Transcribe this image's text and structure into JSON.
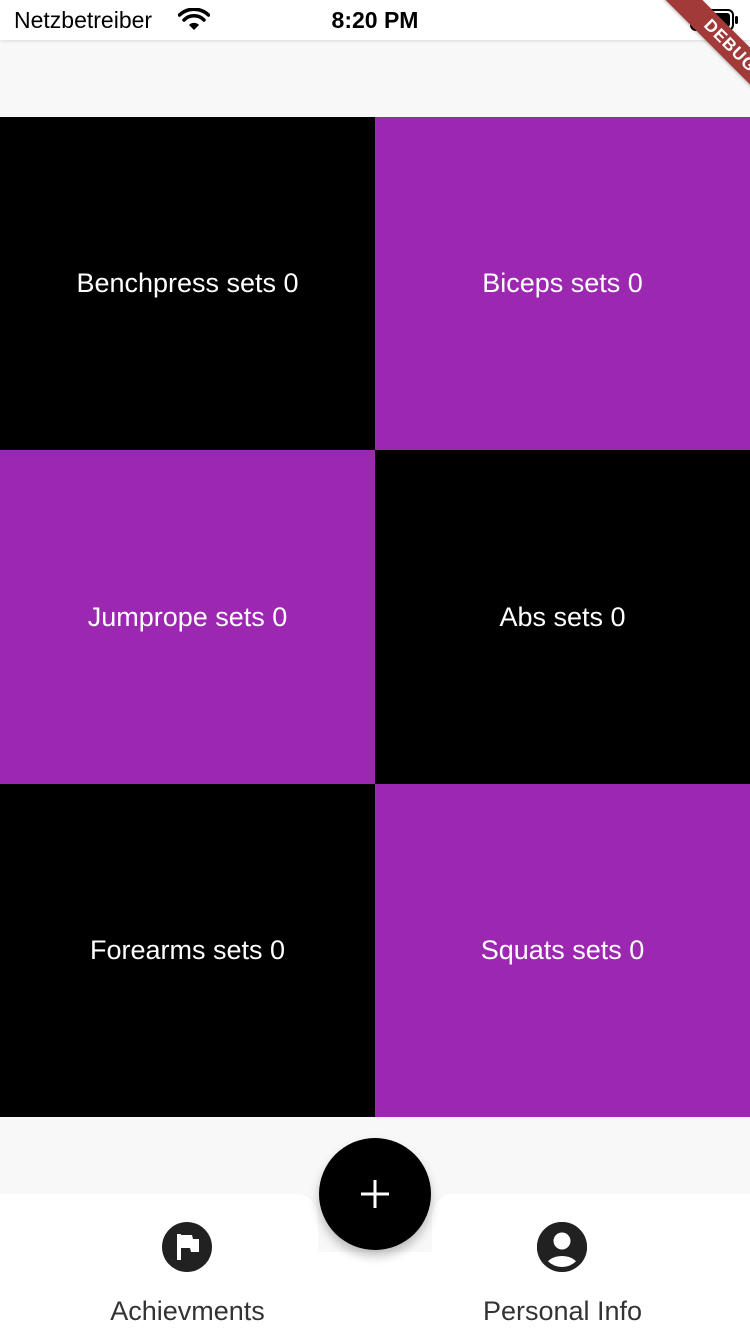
{
  "status_bar": {
    "carrier": "Netzbetreiber",
    "time": "8:20 PM",
    "wifi_icon": "wifi-icon",
    "battery_icon": "battery-full-icon"
  },
  "debug_banner": {
    "label": "DEBUG",
    "color": "#a33a3a"
  },
  "colors": {
    "purple": "#9c27b0",
    "black": "#000000",
    "background": "#f8f8f8"
  },
  "tiles": [
    {
      "label": "Benchpress sets 0",
      "color": "#000000"
    },
    {
      "label": "Biceps sets 0",
      "color": "#9c27b0"
    },
    {
      "label": "Jumprope sets 0",
      "color": "#9c27b0"
    },
    {
      "label": "Abs sets 0",
      "color": "#000000"
    },
    {
      "label": "Forearms sets 0",
      "color": "#000000"
    },
    {
      "label": "Squats sets 0",
      "color": "#9c27b0"
    }
  ],
  "fab": {
    "icon": "plus-icon"
  },
  "bottom_nav": {
    "items": [
      {
        "label": "Achievments",
        "icon": "flag-icon"
      },
      {
        "label": "Personal Info",
        "icon": "account-circle-icon"
      }
    ]
  }
}
